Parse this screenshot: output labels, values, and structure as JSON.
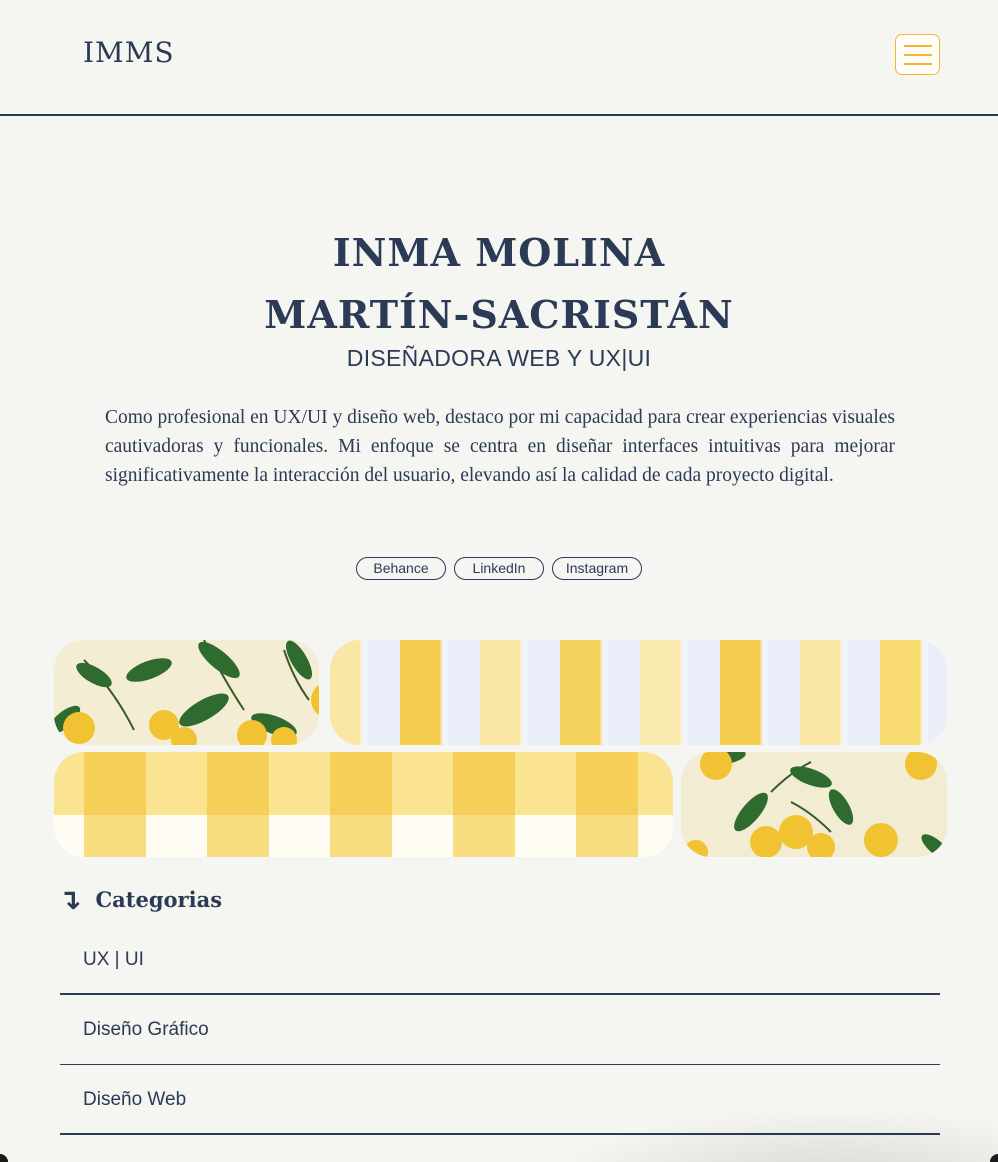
{
  "header": {
    "logo": "IMMS",
    "menu_icon": "hamburger-menu-icon",
    "accent_color": "#f2b535"
  },
  "hero": {
    "name_line1": "INMA MOLINA",
    "name_line2": "MARTÍN-SACRISTÁN",
    "role": "DISEÑADORA WEB Y UX|UI",
    "description": "Como profesional en UX/UI y diseño web, destaco por mi capacidad para crear experiencias visuales cautivadoras y funcionales. Mi enfoque se centra en diseñar interfaces intuitivas para mejorar significativamente la interacción del usuario, elevando así la calidad de cada proyecto digital."
  },
  "socials": [
    {
      "label": "Behance"
    },
    {
      "label": "LinkedIn"
    },
    {
      "label": "Instagram"
    }
  ],
  "gallery": [
    {
      "pattern": "lemons"
    },
    {
      "pattern": "yellow-stripes"
    },
    {
      "pattern": "yellow-gingham"
    },
    {
      "pattern": "lemons"
    }
  ],
  "categories": {
    "icon": "arrow-down-curved-icon",
    "title": "Categorias",
    "items": [
      {
        "label": "UX | UI"
      },
      {
        "label": "Diseño Gráfico"
      },
      {
        "label": "Diseño Web"
      }
    ]
  },
  "colors": {
    "text": "#2b3a55",
    "background": "#f5f5f2",
    "accent": "#f2b535"
  }
}
